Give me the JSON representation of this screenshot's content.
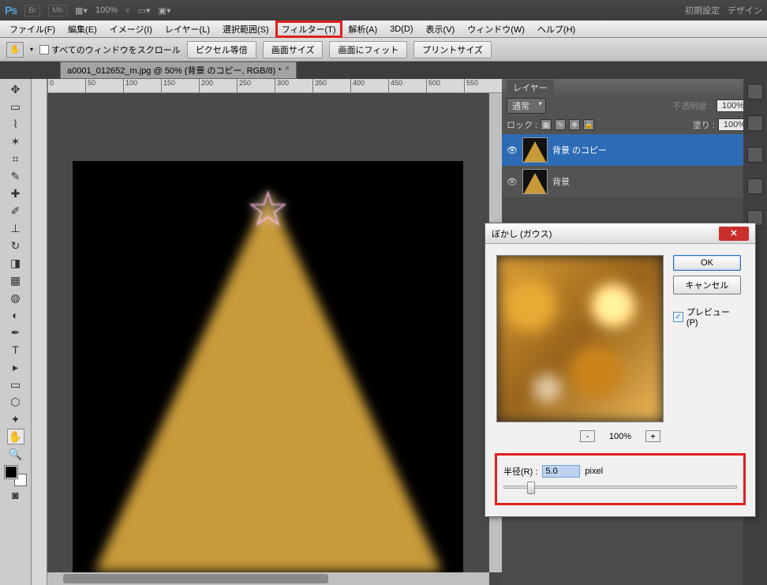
{
  "topbar": {
    "logo": "Ps",
    "br": "Br",
    "mb": "Mb",
    "zoom": "100%",
    "right1": "初期設定",
    "right2": "デザイン"
  },
  "menu": {
    "file": "ファイル(F)",
    "edit": "編集(E)",
    "image": "イメージ(I)",
    "layer": "レイヤー(L)",
    "select": "選択範囲(S)",
    "filter": "フィルター(T)",
    "analysis": "解析(A)",
    "threed": "3D(D)",
    "view": "表示(V)",
    "window": "ウィンドウ(W)",
    "help": "ヘルプ(H)"
  },
  "optbar": {
    "scroll_all": "すべてのウィンドウをスクロール",
    "actual": "ピクセル等倍",
    "fit": "画面サイズ",
    "fill": "画面にフィット",
    "print": "プリントサイズ"
  },
  "doc": {
    "tab": "a0001_012652_m.jpg @ 50% (背景 のコピー, RGB/8) *"
  },
  "ruler": [
    "0",
    "50",
    "100",
    "150",
    "200",
    "250",
    "300",
    "350",
    "400",
    "450",
    "500",
    "550"
  ],
  "layerspanel": {
    "title": "レイヤー",
    "blend": "通常",
    "opacity_label": "不透明度 :",
    "opacity": "100%",
    "lock": "ロック :",
    "fill_label": "塗り :",
    "fill": "100%",
    "layer1": "背景 のコピー",
    "layer2": "背景"
  },
  "dialog": {
    "title": "ぼかし (ガウス)",
    "ok": "OK",
    "cancel": "キャンセル",
    "preview": "プレビュー(P)",
    "zoom": "100%",
    "radius_label": "半径(R) :",
    "radius_value": "5.0",
    "px": "pixel"
  }
}
